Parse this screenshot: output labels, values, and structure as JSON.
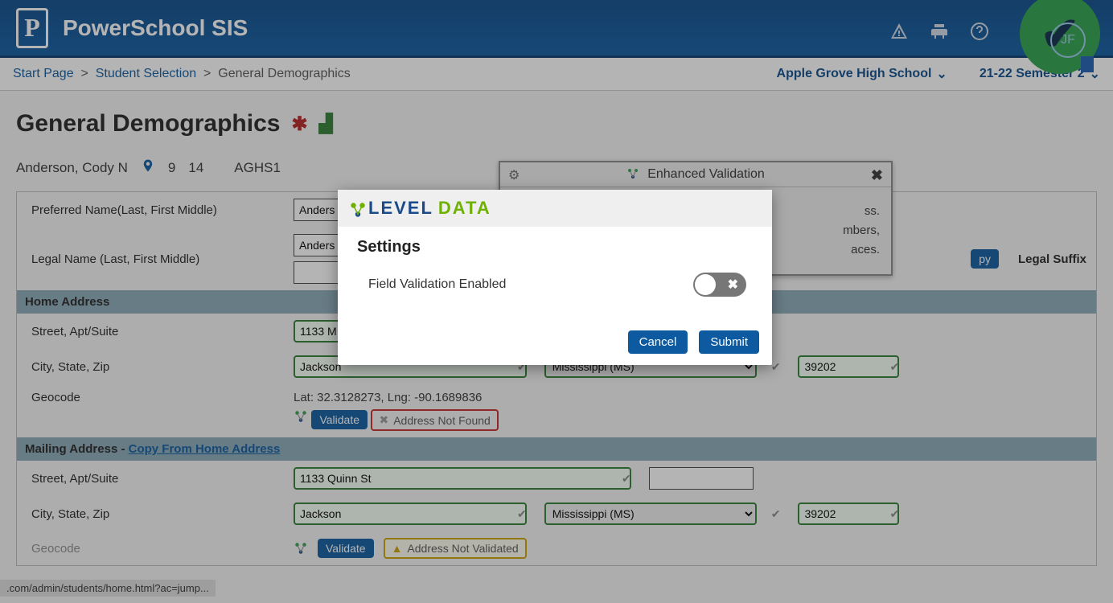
{
  "header": {
    "app_title": "PowerSchool SIS",
    "avatar_initials": "JF"
  },
  "subheader": {
    "breadcrumb": {
      "start": "Start Page",
      "sel": "Student Selection",
      "current": "General Demographics"
    },
    "school": "Apple Grove High School",
    "term": "21-22 Semester 2"
  },
  "page": {
    "title": "General Demographics",
    "student_name": "Anderson, Cody N",
    "grade": "9",
    "age": "14",
    "school_code": "AGHS1"
  },
  "form": {
    "pref_label": "Preferred Name(Last, First Middle)",
    "legal_label": "Legal Name (Last, First Middle)",
    "name_value": "Anders",
    "legal_suffix_label": "Legal Suffix",
    "copy_btn": "py",
    "home_head": "Home Address",
    "mail_head": "Mailing Address - ",
    "copy_home": "Copy From Home Address",
    "street_label": "Street, Apt/Suite",
    "city_label": "City, State, Zip",
    "geocode_label": "Geocode",
    "street_home": "1133 M",
    "street_mail": "1133 Quinn St",
    "city": "Jackson",
    "state": "Mississippi (MS)",
    "zip": "39202",
    "geocode": "Lat: 32.3128273, Lng: -90.1689836",
    "validate_btn": "Validate",
    "addr_not_found": "Address Not Found",
    "addr_not_validated": "Address Not Validated"
  },
  "panel": {
    "title": "Enhanced Validation",
    "line1": "ss.",
    "line2": "mbers,",
    "line3": "aces."
  },
  "modal": {
    "brand_level": "LEVEL",
    "brand_data": "DATA",
    "title": "Settings",
    "row_label": "Field Validation Enabled",
    "cancel": "Cancel",
    "submit": "Submit"
  },
  "status_bar": ".com/admin/students/home.html?ac=jump..."
}
